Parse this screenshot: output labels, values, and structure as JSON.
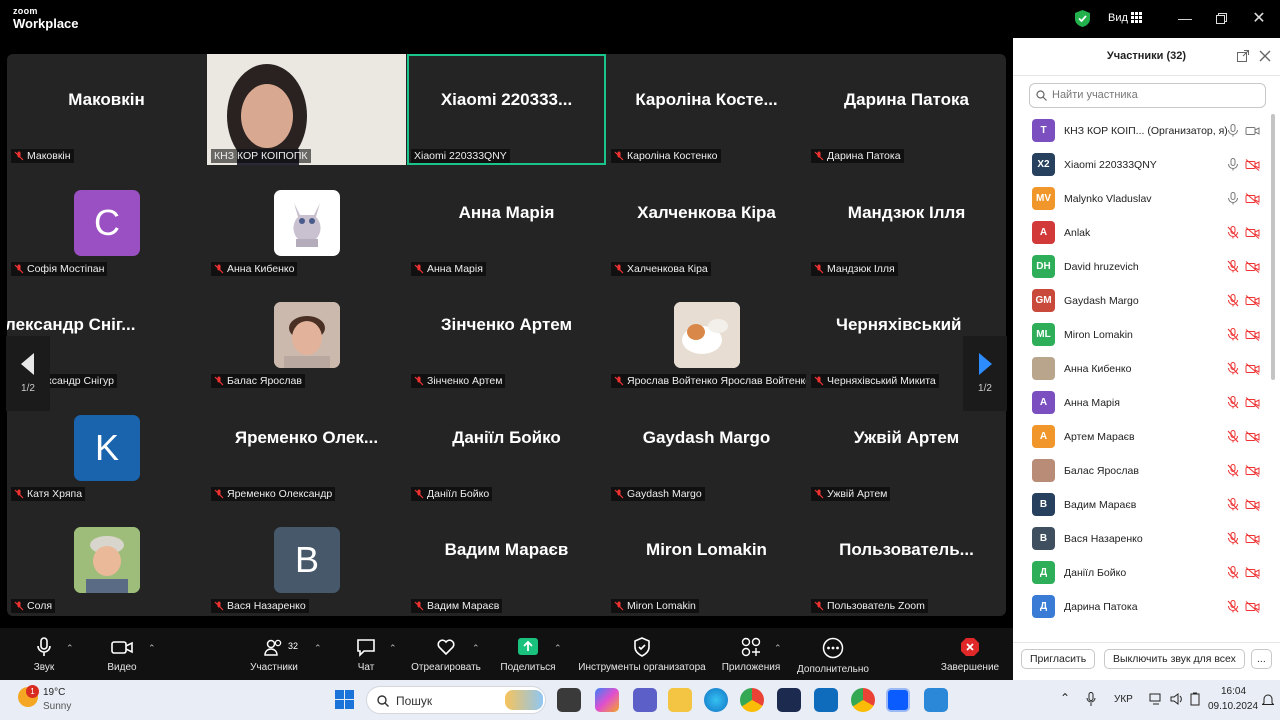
{
  "app": {
    "brand_top": "zoom",
    "brand_bottom": "Workplace",
    "view_label": "Вид"
  },
  "gallery": {
    "page_indicator": "1/2",
    "tiles": [
      {
        "name": "Маковкін",
        "label": "Маковкін"
      },
      {
        "name": "",
        "label": "КНЗ КОР КОІПОПК"
      },
      {
        "name": "Xiaomi  220333...",
        "label": "Xiaomi 220333QNY"
      },
      {
        "name": "Кароліна  Косте...",
        "label": "Кароліна Костенко"
      },
      {
        "name": "Дарина Патока",
        "label": "Дарина Патока"
      },
      {
        "name": "",
        "label": "Софія Мостіпан",
        "avatar_letter": "C"
      },
      {
        "name": "",
        "label": "Анна Кибенко"
      },
      {
        "name": "Анна Марія",
        "label": "Анна Марія"
      },
      {
        "name": "Халченкова Кіра",
        "label": "Халченкова Кіра"
      },
      {
        "name": "Мандзюк Ілля",
        "label": "Мандзюк Ілля"
      },
      {
        "name": "лександр  Сніг...",
        "label": "Олександр Снігур"
      },
      {
        "name": "",
        "label": "Балас Ярослав"
      },
      {
        "name": "Зінченко Артем",
        "label": "Зінченко Артем"
      },
      {
        "name": "",
        "label": "Ярослав Войтенко Ярослав Войтенко"
      },
      {
        "name": "Черняхівський",
        "label": "Черняхівський Микита"
      },
      {
        "name": "",
        "label": "Катя Хряпа",
        "avatar_letter": "K"
      },
      {
        "name": "Яременко  Олек...",
        "label": "Яременко Олександр"
      },
      {
        "name": "Даніїл Бойко",
        "label": "Даніїл Бойко"
      },
      {
        "name": "Gaydash Margo",
        "label": "Gaydash Margo"
      },
      {
        "name": "Ужвій Артем",
        "label": "Ужвій Артем"
      },
      {
        "name": "",
        "label": "Соля"
      },
      {
        "name": "",
        "label": "Вася Назаренко",
        "avatar_letter": "B"
      },
      {
        "name": "Вадим Мараєв",
        "label": "Вадим Мараєв"
      },
      {
        "name": "Miron Lomakin",
        "label": "Miron Lomakin"
      },
      {
        "name": "Пользователь...",
        "label": "Пользователь Zoom"
      }
    ]
  },
  "toolbar": {
    "audio": "Звук",
    "video": "Видео",
    "participants": "Участники",
    "participants_count": "32",
    "chat": "Чат",
    "react": "Отреагировать",
    "share": "Поделиться",
    "host_tools": "Инструменты организатора",
    "apps": "Приложения",
    "more": "Дополнительно",
    "end": "Завершение"
  },
  "panel": {
    "title": "Участники (32)",
    "search_placeholder": "Найти участника",
    "invite": "Пригласить",
    "mute_all": "Выключить звук для всех",
    "more": "...",
    "participants": [
      {
        "initials": "T",
        "name": "КНЗ КОР КОІП...  (Организатор, я)",
        "color": "#7b4fbf"
      },
      {
        "initials": "X2",
        "name": "Xiaomi 220333QNY",
        "color": "#27405d"
      },
      {
        "initials": "MV",
        "name": "Malynko Vladuslav",
        "color": "#f0962a"
      },
      {
        "initials": "A",
        "name": "Anlak",
        "color": "#d23a3a"
      },
      {
        "initials": "DH",
        "name": "David hruzevich",
        "color": "#2fae5a"
      },
      {
        "initials": "GM",
        "name": "Gaydash Margo",
        "color": "#c94a3a"
      },
      {
        "initials": "ML",
        "name": "Miron Lomakin",
        "color": "#2fae5a"
      },
      {
        "initials": "",
        "name": "Анна Кибенко",
        "color": "#b9a58c"
      },
      {
        "initials": "A",
        "name": "Анна Марія",
        "color": "#7b4fbf"
      },
      {
        "initials": "A",
        "name": "Артем Мараєв",
        "color": "#f0962a"
      },
      {
        "initials": "",
        "name": "Балас Ярослав",
        "color": "#b88c76"
      },
      {
        "initials": "B",
        "name": "Вадим Мараєв",
        "color": "#27405d"
      },
      {
        "initials": "B",
        "name": "Вася Назаренко",
        "color": "#3f4f5f"
      },
      {
        "initials": "Д",
        "name": "Даніїл Бойко",
        "color": "#2fae5a"
      },
      {
        "initials": "Д",
        "name": "Дарина Патока",
        "color": "#3a7bd5"
      }
    ]
  },
  "weather": {
    "temp": "19°C",
    "desc": "Sunny",
    "badge": "1"
  },
  "taskbar": {
    "search": "Пошук",
    "lang": "УКР",
    "time": "16:04",
    "date": "09.10.2024"
  }
}
